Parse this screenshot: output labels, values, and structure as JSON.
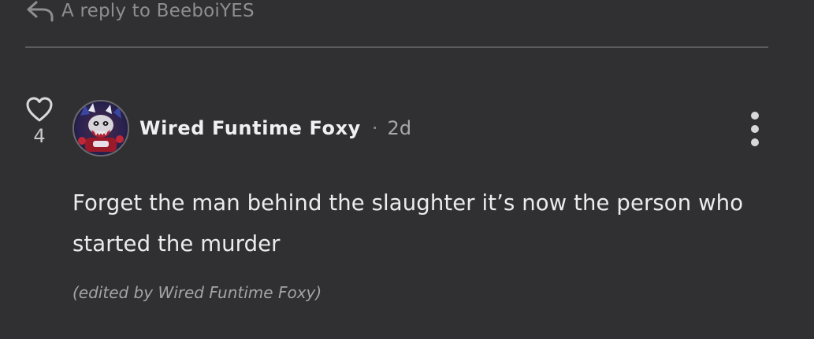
{
  "reply_context": {
    "text": "A reply to BeeboiYES",
    "icon": "reply-arrow-icon"
  },
  "comment": {
    "like_count": "4",
    "like_icon": "heart-icon",
    "author": "Wired Funtime Foxy",
    "separator": "·",
    "time_ago": "2d",
    "body": "Forget the man behind the slaughter it’s now the person who started the murder",
    "edited_note": "(edited by Wired Funtime Foxy)",
    "more_icon": "more-vertical-icon"
  },
  "colors": {
    "background": "#303033",
    "divider": "#5c5c60",
    "muted_text": "#8e8e92",
    "body_text": "#ececee"
  }
}
